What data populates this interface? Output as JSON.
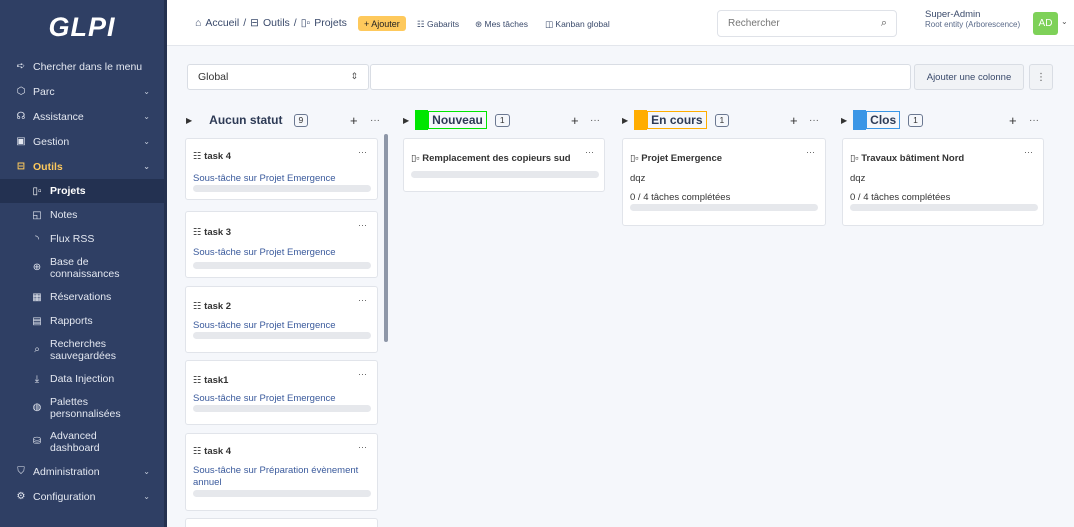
{
  "app": {
    "logo": "GLPI"
  },
  "sidebar": {
    "items": [
      {
        "label": "Chercher dans le menu",
        "icon": "arrow-right-icon"
      },
      {
        "label": "Parc",
        "icon": "cube-icon"
      },
      {
        "label": "Assistance",
        "icon": "headset-icon"
      },
      {
        "label": "Gestion",
        "icon": "wallet-icon"
      },
      {
        "label": "Outils",
        "icon": "briefcase-icon"
      }
    ],
    "subitems": [
      {
        "label": "Projets",
        "icon": "projects-icon"
      },
      {
        "label": "Notes",
        "icon": "note-icon"
      },
      {
        "label": "Flux RSS",
        "icon": "rss-icon"
      },
      {
        "label_line1": "Base de",
        "label_line2": "connaissances",
        "icon": "lifebuoy-icon"
      },
      {
        "label": "Réservations",
        "icon": "calendar-icon"
      },
      {
        "label": "Rapports",
        "icon": "report-icon"
      },
      {
        "label_line1": "Recherches",
        "label_line2": "sauvegardées",
        "icon": "bookmark-icon"
      },
      {
        "label": "Data Injection",
        "icon": "download-icon"
      },
      {
        "label_line1": "Palettes",
        "label_line2": "personnalisées",
        "icon": "palette-icon"
      },
      {
        "label_line1": "Advanced",
        "label_line2": "dashboard",
        "icon": "database-icon"
      }
    ],
    "bottom": [
      {
        "label": "Administration",
        "icon": "shield-icon"
      },
      {
        "label": "Configuration",
        "icon": "gear-icon"
      }
    ]
  },
  "header": {
    "breadcrumb": [
      "Accueil",
      "/",
      "Outils",
      "/",
      "Projets"
    ],
    "add_label": "+ Ajouter",
    "links": [
      "Gabarits",
      "Mes tâches",
      "Kanban global"
    ],
    "search_placeholder": "Rechercher",
    "user_name": "Super-Admin",
    "user_entity": "Root entity (Arborescence)",
    "avatar_initials": "AD"
  },
  "toolbar": {
    "select_value": "Global",
    "add_column_label": "Ajouter une colonne",
    "kebab": "⋮"
  },
  "columns": [
    {
      "title": "Aucun statut",
      "count": "9",
      "color": null,
      "cards": [
        {
          "title": "task 4",
          "link": "Sous-tâche sur Projet Emergence"
        },
        {
          "title": "task 3",
          "link": "Sous-tâche sur Projet Emergence"
        },
        {
          "title": "task 2",
          "link": "Sous-tâche sur Projet Emergence"
        },
        {
          "title": "task1",
          "link": "Sous-tâche sur Projet Emergence"
        },
        {
          "title": "task 4",
          "link_line1": "Sous-tâche sur Préparation évènement",
          "link_line2": "annuel"
        }
      ]
    },
    {
      "title": "Nouveau",
      "count": "1",
      "color": "#00e600",
      "cards": [
        {
          "title": "Remplacement des copieurs sud"
        }
      ]
    },
    {
      "title": "En cours",
      "count": "1",
      "color": "#ffad00",
      "cards": [
        {
          "title": "Projet Emergence",
          "desc": "dqz",
          "progress": "0 / 4 tâches complétées"
        }
      ]
    },
    {
      "title": "Clos",
      "count": "1",
      "color": "#3b96e6",
      "cards": [
        {
          "title": "Travaux bâtiment Nord",
          "desc": "dqz",
          "progress": "0 / 4 tâches complétées"
        }
      ]
    }
  ]
}
